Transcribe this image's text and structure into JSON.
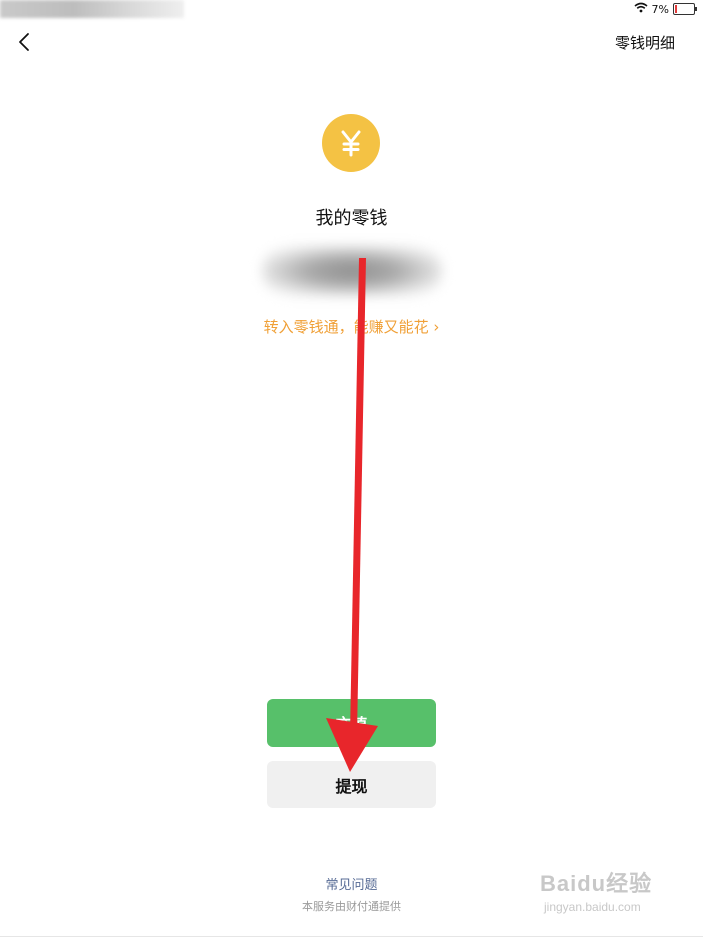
{
  "status_bar": {
    "battery_text": "7%",
    "battery_level": 0.07
  },
  "nav": {
    "back_icon": "chevron-left-icon",
    "right_link": "零钱明细"
  },
  "wallet": {
    "coin_symbol": "¥",
    "title": "我的零钱",
    "promo_text": "转入零钱通，能赚又能花 ›"
  },
  "actions": {
    "primary_label": "充值",
    "secondary_label": "提现"
  },
  "footer": {
    "faq_label": "常见问题",
    "provider_note": "本服务由财付通提供"
  },
  "watermark": {
    "brand": "Baidu经验",
    "url": "jingyan.baidu.com"
  },
  "colors": {
    "coin": "#f4c244",
    "promo": "#f0a037",
    "primary_button": "#57c06a",
    "secondary_button": "#f0f0f0",
    "faq_link": "#576b95",
    "annotation_arrow": "#e8262b"
  }
}
